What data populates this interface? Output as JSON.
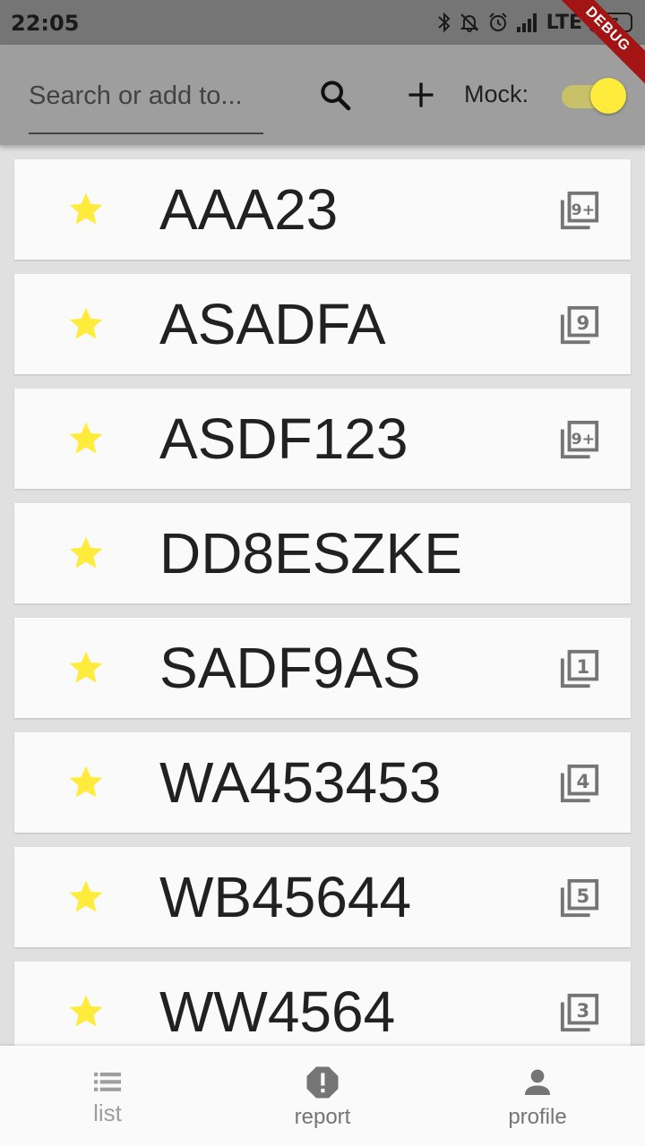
{
  "status_bar": {
    "time": "22:05",
    "network": "LTE",
    "battery": "47",
    "battery_level": 0.47
  },
  "debug_banner": "DEBUG",
  "app_bar": {
    "search_placeholder": "Search or add to...",
    "search_icon": "search-icon",
    "add_icon": "add-icon",
    "mock_label": "Mock:",
    "mock_enabled": true
  },
  "colors": {
    "star": "#ffeb3b",
    "app_bar": "#9e9e9e",
    "status_bar": "#757575",
    "toggle_thumb": "#ffeb3b"
  },
  "items": [
    {
      "name": "AAA23",
      "favorite": true,
      "badge": "9+"
    },
    {
      "name": "ASADFA",
      "favorite": true,
      "badge": "9"
    },
    {
      "name": "ASDF123",
      "favorite": true,
      "badge": "9+"
    },
    {
      "name": "DD8ESZKE",
      "favorite": true,
      "badge": ""
    },
    {
      "name": "SADF9AS",
      "favorite": true,
      "badge": "1"
    },
    {
      "name": "WA453453",
      "favorite": true,
      "badge": "4"
    },
    {
      "name": "WB45644",
      "favorite": true,
      "badge": "5"
    },
    {
      "name": "WW4564",
      "favorite": true,
      "badge": "3"
    }
  ],
  "bottom_nav": {
    "items": [
      {
        "label": "list",
        "icon": "list-icon",
        "active": true
      },
      {
        "label": "report",
        "icon": "report-icon",
        "active": false
      },
      {
        "label": "profile",
        "icon": "person-icon",
        "active": false
      }
    ]
  }
}
